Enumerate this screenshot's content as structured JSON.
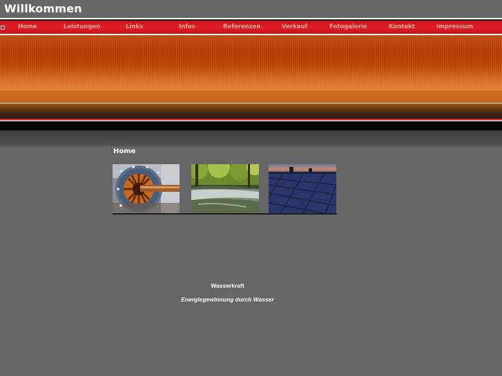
{
  "header": {
    "title": "Willkommen"
  },
  "nav": {
    "items": [
      {
        "label": "Home"
      },
      {
        "label": "Leistungen"
      },
      {
        "label": "Links"
      },
      {
        "label": "Infos"
      },
      {
        "label": "Referenzen"
      },
      {
        "label": "Verkauf"
      },
      {
        "label": "Fotogalerie"
      },
      {
        "label": "Kontakt"
      },
      {
        "label": "Impressum"
      }
    ]
  },
  "main": {
    "heading": "Home",
    "gallery": [
      {
        "icon": "turbine-photo"
      },
      {
        "icon": "river-photo"
      },
      {
        "icon": "solar-panel-photo"
      }
    ],
    "caption_title": "Wasserkraft",
    "caption_subtitle": "Energiegewinnung durch Wasser"
  },
  "colors": {
    "background": "#666666",
    "nav_bar": "#e21d22",
    "nav_text": "#f6a6a0",
    "banner_orange": "#b43c02"
  }
}
